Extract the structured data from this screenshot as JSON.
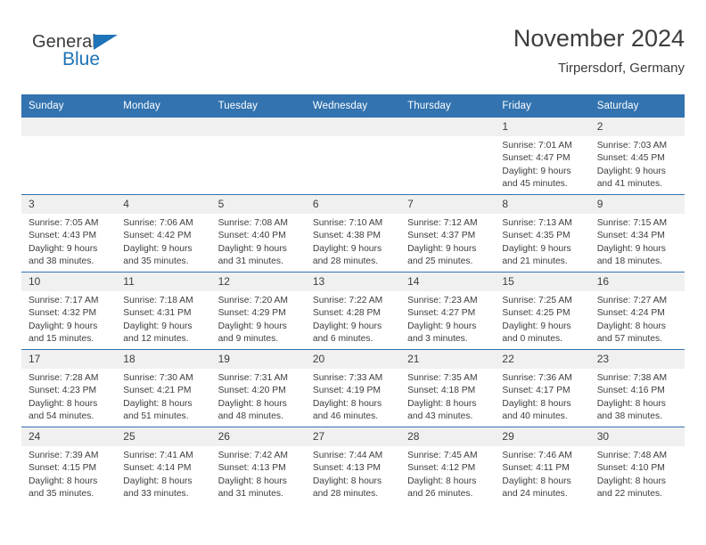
{
  "brand": {
    "name_part1": "General",
    "name_part2": "Blue",
    "accent_color": "#1f73b7",
    "triangle_icon": "brand-triangle-icon"
  },
  "header": {
    "title": "November 2024",
    "subtitle": "Tirpersdorf, Germany"
  },
  "theme": {
    "header_bg": "#3273b0",
    "row_divider": "#3273b0",
    "daynum_bg": "#f0f0f0",
    "text": "#3d3d3d"
  },
  "weekday_headers": [
    "Sunday",
    "Monday",
    "Tuesday",
    "Wednesday",
    "Thursday",
    "Friday",
    "Saturday"
  ],
  "labels": {
    "sunrise_prefix": "Sunrise: ",
    "sunset_prefix": "Sunset: ",
    "daylight_prefix": "Daylight: "
  },
  "weeks": [
    [
      {
        "day": "",
        "empty": true
      },
      {
        "day": "",
        "empty": true
      },
      {
        "day": "",
        "empty": true
      },
      {
        "day": "",
        "empty": true
      },
      {
        "day": "",
        "empty": true
      },
      {
        "day": "1",
        "sunrise": "Sunrise: 7:01 AM",
        "sunset": "Sunset: 4:47 PM",
        "daylight": "Daylight: 9 hours and 45 minutes."
      },
      {
        "day": "2",
        "sunrise": "Sunrise: 7:03 AM",
        "sunset": "Sunset: 4:45 PM",
        "daylight": "Daylight: 9 hours and 41 minutes."
      }
    ],
    [
      {
        "day": "3",
        "sunrise": "Sunrise: 7:05 AM",
        "sunset": "Sunset: 4:43 PM",
        "daylight": "Daylight: 9 hours and 38 minutes."
      },
      {
        "day": "4",
        "sunrise": "Sunrise: 7:06 AM",
        "sunset": "Sunset: 4:42 PM",
        "daylight": "Daylight: 9 hours and 35 minutes."
      },
      {
        "day": "5",
        "sunrise": "Sunrise: 7:08 AM",
        "sunset": "Sunset: 4:40 PM",
        "daylight": "Daylight: 9 hours and 31 minutes."
      },
      {
        "day": "6",
        "sunrise": "Sunrise: 7:10 AM",
        "sunset": "Sunset: 4:38 PM",
        "daylight": "Daylight: 9 hours and 28 minutes."
      },
      {
        "day": "7",
        "sunrise": "Sunrise: 7:12 AM",
        "sunset": "Sunset: 4:37 PM",
        "daylight": "Daylight: 9 hours and 25 minutes."
      },
      {
        "day": "8",
        "sunrise": "Sunrise: 7:13 AM",
        "sunset": "Sunset: 4:35 PM",
        "daylight": "Daylight: 9 hours and 21 minutes."
      },
      {
        "day": "9",
        "sunrise": "Sunrise: 7:15 AM",
        "sunset": "Sunset: 4:34 PM",
        "daylight": "Daylight: 9 hours and 18 minutes."
      }
    ],
    [
      {
        "day": "10",
        "sunrise": "Sunrise: 7:17 AM",
        "sunset": "Sunset: 4:32 PM",
        "daylight": "Daylight: 9 hours and 15 minutes."
      },
      {
        "day": "11",
        "sunrise": "Sunrise: 7:18 AM",
        "sunset": "Sunset: 4:31 PM",
        "daylight": "Daylight: 9 hours and 12 minutes."
      },
      {
        "day": "12",
        "sunrise": "Sunrise: 7:20 AM",
        "sunset": "Sunset: 4:29 PM",
        "daylight": "Daylight: 9 hours and 9 minutes."
      },
      {
        "day": "13",
        "sunrise": "Sunrise: 7:22 AM",
        "sunset": "Sunset: 4:28 PM",
        "daylight": "Daylight: 9 hours and 6 minutes."
      },
      {
        "day": "14",
        "sunrise": "Sunrise: 7:23 AM",
        "sunset": "Sunset: 4:27 PM",
        "daylight": "Daylight: 9 hours and 3 minutes."
      },
      {
        "day": "15",
        "sunrise": "Sunrise: 7:25 AM",
        "sunset": "Sunset: 4:25 PM",
        "daylight": "Daylight: 9 hours and 0 minutes."
      },
      {
        "day": "16",
        "sunrise": "Sunrise: 7:27 AM",
        "sunset": "Sunset: 4:24 PM",
        "daylight": "Daylight: 8 hours and 57 minutes."
      }
    ],
    [
      {
        "day": "17",
        "sunrise": "Sunrise: 7:28 AM",
        "sunset": "Sunset: 4:23 PM",
        "daylight": "Daylight: 8 hours and 54 minutes."
      },
      {
        "day": "18",
        "sunrise": "Sunrise: 7:30 AM",
        "sunset": "Sunset: 4:21 PM",
        "daylight": "Daylight: 8 hours and 51 minutes."
      },
      {
        "day": "19",
        "sunrise": "Sunrise: 7:31 AM",
        "sunset": "Sunset: 4:20 PM",
        "daylight": "Daylight: 8 hours and 48 minutes."
      },
      {
        "day": "20",
        "sunrise": "Sunrise: 7:33 AM",
        "sunset": "Sunset: 4:19 PM",
        "daylight": "Daylight: 8 hours and 46 minutes."
      },
      {
        "day": "21",
        "sunrise": "Sunrise: 7:35 AM",
        "sunset": "Sunset: 4:18 PM",
        "daylight": "Daylight: 8 hours and 43 minutes."
      },
      {
        "day": "22",
        "sunrise": "Sunrise: 7:36 AM",
        "sunset": "Sunset: 4:17 PM",
        "daylight": "Daylight: 8 hours and 40 minutes."
      },
      {
        "day": "23",
        "sunrise": "Sunrise: 7:38 AM",
        "sunset": "Sunset: 4:16 PM",
        "daylight": "Daylight: 8 hours and 38 minutes."
      }
    ],
    [
      {
        "day": "24",
        "sunrise": "Sunrise: 7:39 AM",
        "sunset": "Sunset: 4:15 PM",
        "daylight": "Daylight: 8 hours and 35 minutes."
      },
      {
        "day": "25",
        "sunrise": "Sunrise: 7:41 AM",
        "sunset": "Sunset: 4:14 PM",
        "daylight": "Daylight: 8 hours and 33 minutes."
      },
      {
        "day": "26",
        "sunrise": "Sunrise: 7:42 AM",
        "sunset": "Sunset: 4:13 PM",
        "daylight": "Daylight: 8 hours and 31 minutes."
      },
      {
        "day": "27",
        "sunrise": "Sunrise: 7:44 AM",
        "sunset": "Sunset: 4:13 PM",
        "daylight": "Daylight: 8 hours and 28 minutes."
      },
      {
        "day": "28",
        "sunrise": "Sunrise: 7:45 AM",
        "sunset": "Sunset: 4:12 PM",
        "daylight": "Daylight: 8 hours and 26 minutes."
      },
      {
        "day": "29",
        "sunrise": "Sunrise: 7:46 AM",
        "sunset": "Sunset: 4:11 PM",
        "daylight": "Daylight: 8 hours and 24 minutes."
      },
      {
        "day": "30",
        "sunrise": "Sunrise: 7:48 AM",
        "sunset": "Sunset: 4:10 PM",
        "daylight": "Daylight: 8 hours and 22 minutes."
      }
    ]
  ]
}
